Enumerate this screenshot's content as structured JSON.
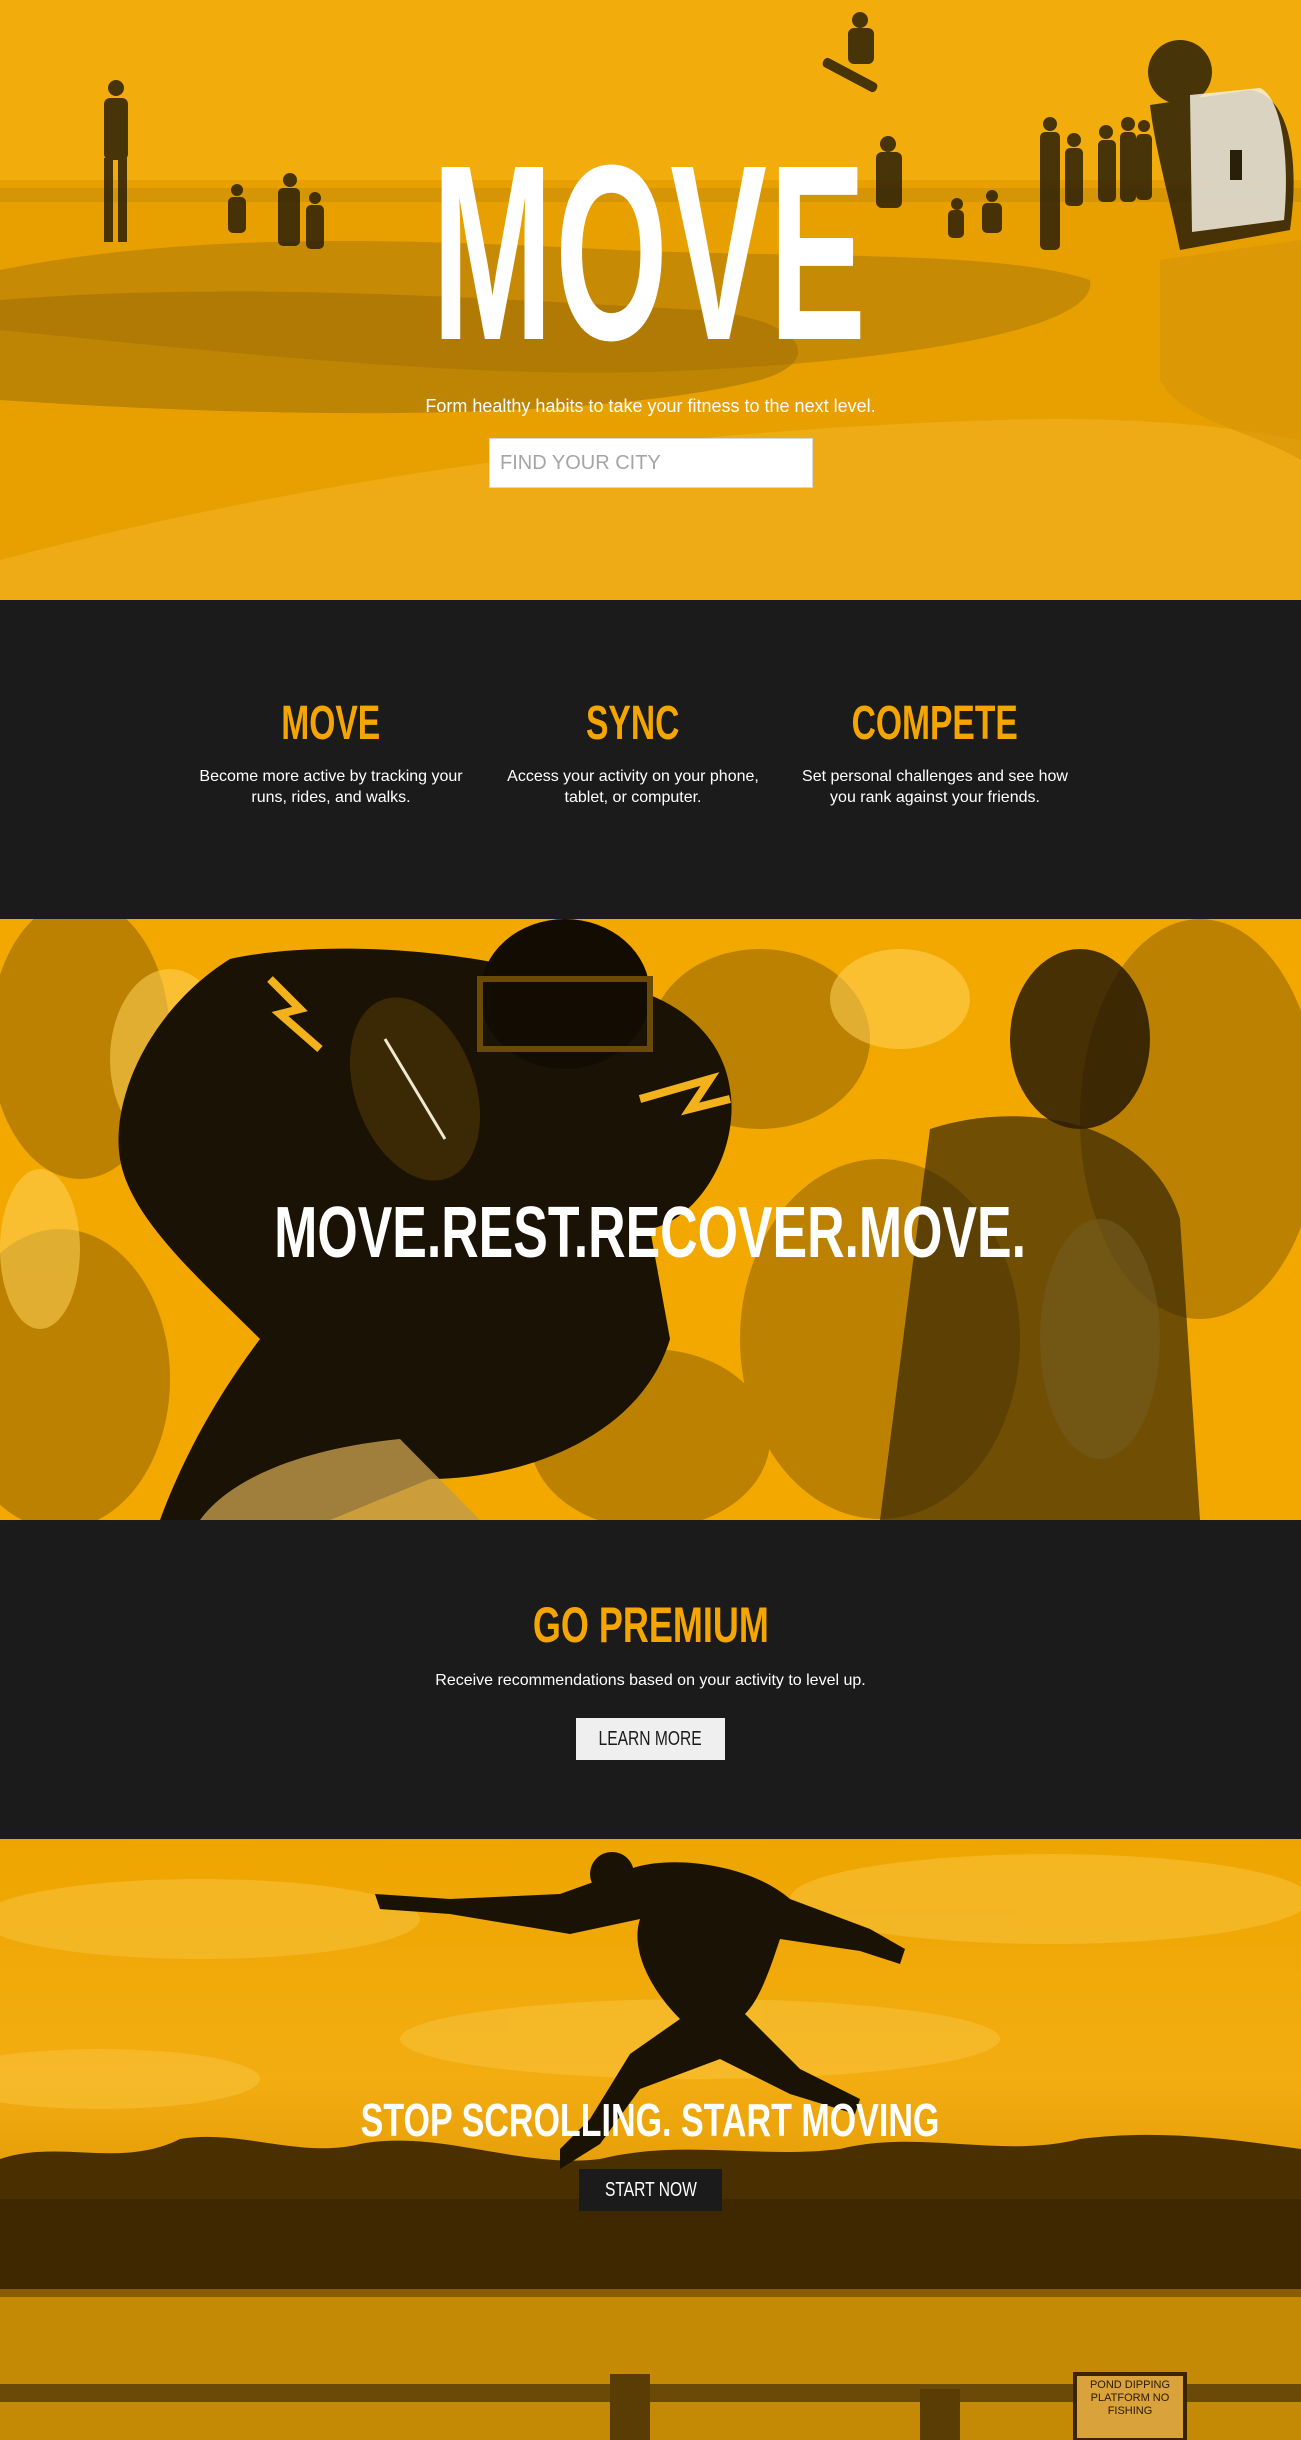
{
  "hero": {
    "title": "MOVE",
    "subtitle": "Form healthy habits to take your fitness to the next level.",
    "search_placeholder": "FIND YOUR CITY"
  },
  "features": [
    {
      "title": "MOVE",
      "text": "Become more active by tracking your runs, rides, and walks."
    },
    {
      "title": "SYNC",
      "text": "Access your activity on your phone, tablet, or computer."
    },
    {
      "title": "COMPETE",
      "text": "Set personal challenges and see how you rank against your friends."
    }
  ],
  "band": {
    "text": "MOVE.REST.RECOVER.MOVE."
  },
  "premium": {
    "title": "GO PREMIUM",
    "text": "Receive recommendations based on your activity to level up.",
    "button": "LEARN MORE"
  },
  "cta": {
    "text": "STOP SCROLLING. START MOVING",
    "button": "START NOW",
    "sign_text": "POND DIPPING PLATFORM NO FISHING"
  },
  "colors": {
    "accent": "#f5a500",
    "dark": "#1b1b1b",
    "white": "#ffffff"
  }
}
